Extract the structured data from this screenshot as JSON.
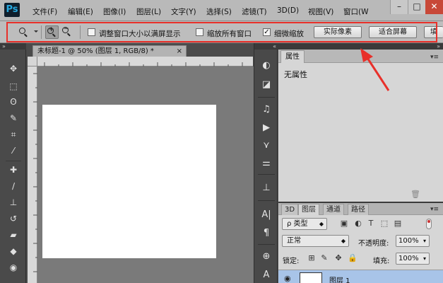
{
  "app": {
    "logo": "Ps"
  },
  "menu": [
    "文件(F)",
    "编辑(E)",
    "图像(I)",
    "图层(L)",
    "文字(Y)",
    "选择(S)",
    "滤镜(T)",
    "3D(D)",
    "视图(V)",
    "窗口(W"
  ],
  "window_controls": {
    "minimize": "–",
    "maximize": "□",
    "close": "✕"
  },
  "options_bar": {
    "zoom_in_sign": "+",
    "zoom_out_sign": "−",
    "resize_windows_label": "调整窗口大小以满屏显示",
    "resize_windows_checked": false,
    "zoom_all_windows_label": "缩放所有窗口",
    "zoom_all_windows_checked": false,
    "scrubby_zoom_label": "细微缩放",
    "scrubby_zoom_checked": true,
    "check_mark": "✓",
    "actual_pixels_label": "实际像素",
    "fit_screen_label": "适合屏幕",
    "fill_screen_label": "填"
  },
  "document": {
    "tab_title": "未标题-1 @ 50% (图层 1, RGB/8) *",
    "close_symbol": "×"
  },
  "properties_panel": {
    "tab": "属性",
    "empty_text": "无属性",
    "menu_symbol": "▾≡"
  },
  "layers_panel": {
    "tabs": [
      "3D",
      "图层",
      "通道",
      "路径"
    ],
    "active_tab": "图层",
    "filter_kind": "ρ 类型",
    "blend_mode": "正常",
    "opacity_label": "不透明度:",
    "opacity_value": "100%",
    "lock_label": "锁定:",
    "fill_label": "填充:",
    "fill_value": "100%",
    "layer_name": "图层 1"
  },
  "colors": {
    "highlight": "#e8302a",
    "selected_layer": "#a8c4e8"
  }
}
